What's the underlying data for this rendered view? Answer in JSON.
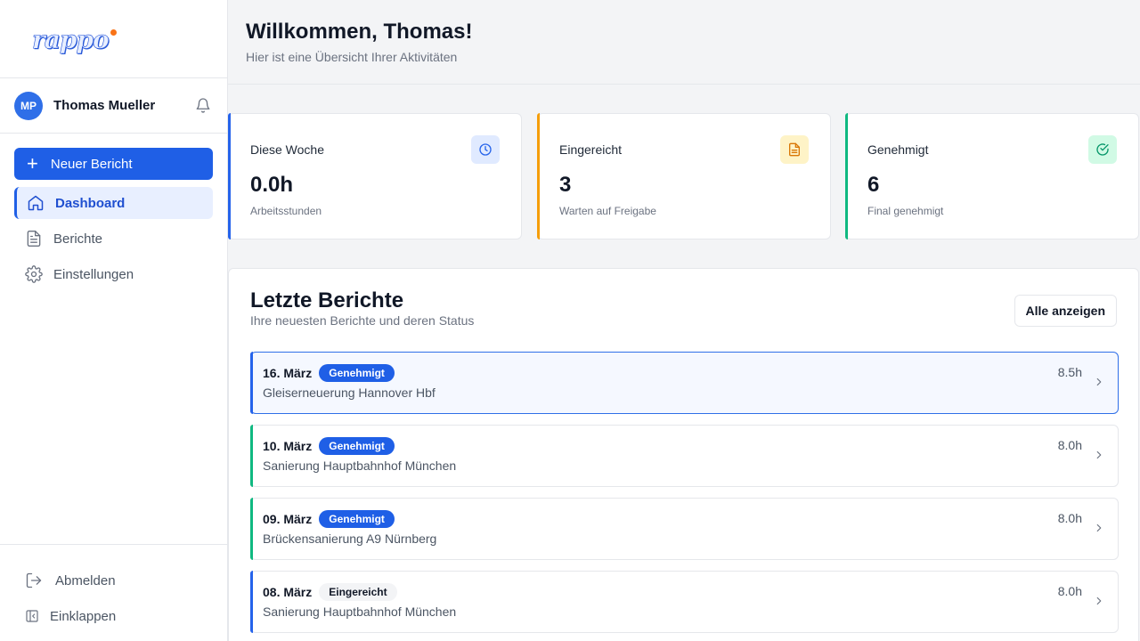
{
  "brand": {
    "logo_text": "rappo",
    "accent": "#1f5fe6",
    "dot_color": "#f97316"
  },
  "user": {
    "initials": "MP",
    "name": "Thomas Mueller"
  },
  "sidebar": {
    "new_report_label": "Neuer Bericht",
    "items": [
      {
        "label": "Dashboard",
        "icon": "home-icon",
        "active": true
      },
      {
        "label": "Berichte",
        "icon": "document-icon",
        "active": false
      },
      {
        "label": "Einstellungen",
        "icon": "gear-icon",
        "active": false
      }
    ],
    "footer": [
      {
        "label": "Abmelden",
        "icon": "logout-icon"
      },
      {
        "label": "Einklappen",
        "icon": "collapse-icon"
      }
    ]
  },
  "header": {
    "title": "Willkommen, Thomas!",
    "subtitle": "Hier ist eine Übersicht Ihrer Aktivitäten"
  },
  "stats": [
    {
      "label": "Diese Woche",
      "value": "0.0h",
      "note": "Arbeitsstunden",
      "icon": "clock-icon",
      "color": "#2563eb"
    },
    {
      "label": "Eingereicht",
      "value": "3",
      "note": "Warten auf Freigabe",
      "icon": "document-icon",
      "color": "#f59e0b"
    },
    {
      "label": "Genehmigt",
      "value": "6",
      "note": "Final genehmigt",
      "icon": "check-circle-icon",
      "color": "#10b981"
    }
  ],
  "recent": {
    "title": "Letzte Berichte",
    "subtitle": "Ihre neuesten Berichte und deren Status",
    "all_label": "Alle anzeigen",
    "reports": [
      {
        "date": "16. März",
        "status": "Genehmigt",
        "title": "Gleiserneuerung Hannover Hbf",
        "hours": "8.5h"
      },
      {
        "date": "10. März",
        "status": "Genehmigt",
        "title": "Sanierung Hauptbahnhof München",
        "hours": "8.0h"
      },
      {
        "date": "09. März",
        "status": "Genehmigt",
        "title": "Brückensanierung A9 Nürnberg",
        "hours": "8.0h"
      },
      {
        "date": "08. März",
        "status": "Eingereicht",
        "title": "Sanierung Hauptbahnhof München",
        "hours": "8.0h"
      }
    ]
  }
}
